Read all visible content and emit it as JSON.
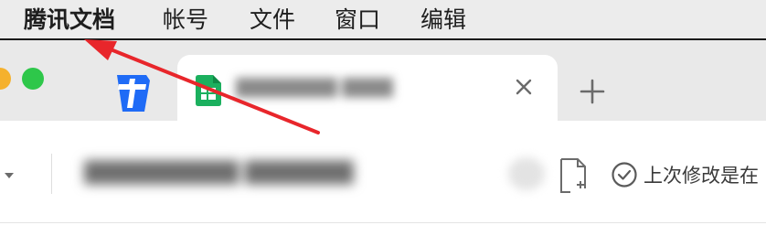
{
  "menubar": {
    "app_name": "腾讯文档",
    "items": [
      "帐号",
      "文件",
      "窗口",
      "编辑"
    ]
  },
  "tab": {
    "title": "████████ ████",
    "add_label": "+"
  },
  "toolbar": {
    "doc_title": "██████████ ███████",
    "save_status": "上次修改是在"
  },
  "colors": {
    "menubar_bg": "#ececec",
    "tabstrip_bg": "#e9e9e9",
    "app_logo_blue": "#1f6bf6",
    "sheet_green": "#1bb05e",
    "annotation_red": "#e8262b",
    "traffic_green": "#2ec74a",
    "traffic_yellow": "#f5b12d"
  },
  "icons": {
    "app_logo": "tencent-docs-logo-icon",
    "tab_doc_type": "spreadsheet-icon",
    "close": "close-icon",
    "new_tab": "plus-icon",
    "dropdown": "chevron-down-icon",
    "page": "document-page-icon",
    "saved": "check-circle-icon"
  }
}
